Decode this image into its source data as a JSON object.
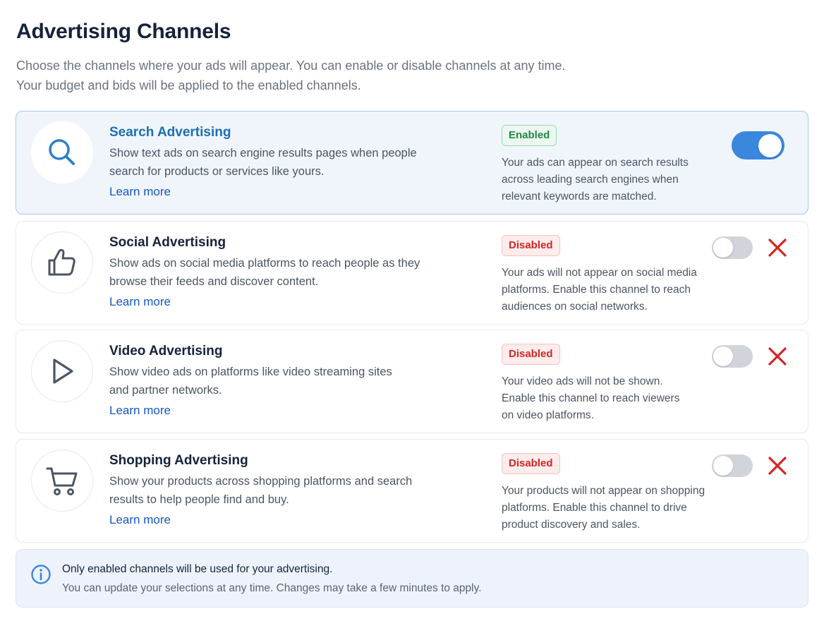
{
  "header": {
    "title": "Advertising Channels",
    "description_line1": "Choose the channels where your ads will appear. You can enable or disable channels at any time.",
    "description_line2": "Your budget and bids will be applied to the enabled channels."
  },
  "channels": [
    {
      "name": "Search Advertising",
      "icon": "search-icon",
      "desc_line1": "Show text ads on search engine results pages when people",
      "desc_line2": "search for products or services like yours.",
      "learn_more": "Learn more",
      "status": "Enabled",
      "status_desc_line1": "Your ads can appear on search results",
      "status_desc_line2": "across leading search engines when",
      "status_desc_line3": "relevant keywords are matched.",
      "enabled": true
    },
    {
      "name": "Social Advertising",
      "icon": "thumbs-up-icon",
      "desc_line1": "Show ads on social media platforms to reach people as they",
      "desc_line2": "browse their feeds and discover content.",
      "learn_more": "Learn more",
      "status": "Disabled",
      "status_desc_line1": "Your ads will not appear on social media",
      "status_desc_line2": "platforms. Enable this channel to reach",
      "status_desc_line3": "audiences on social networks.",
      "enabled": false
    },
    {
      "name": "Video Advertising",
      "icon": "play-icon",
      "desc_line1": "Show video ads on platforms like video streaming sites",
      "desc_line2": "and partner networks.",
      "learn_more": "Learn more",
      "status": "Disabled",
      "status_desc_line1": "Your video ads will not be shown.",
      "status_desc_line2": "Enable this channel to reach viewers",
      "status_desc_line3": "on video platforms.",
      "enabled": false
    },
    {
      "name": "Shopping Advertising",
      "icon": "shopping-cart-icon",
      "desc_line1": "Show your products across shopping platforms and search",
      "desc_line2": "results to help people find and buy.",
      "learn_more": "Learn more",
      "status": "Disabled",
      "status_desc_line1": "Your products will not appear on shopping",
      "status_desc_line2": "platforms. Enable this channel to drive",
      "status_desc_line3": "product discovery and sales.",
      "enabled": false
    }
  ],
  "info": {
    "icon": "info-icon",
    "title": "Only enabled channels will be used for your advertising.",
    "text": "You can update your selections at any time. Changes may take a few minutes to apply."
  },
  "colors": {
    "accent": "#3a87de",
    "enabled_green": "#1e8a43",
    "disabled_red": "#d32626",
    "link": "#1458c4"
  }
}
